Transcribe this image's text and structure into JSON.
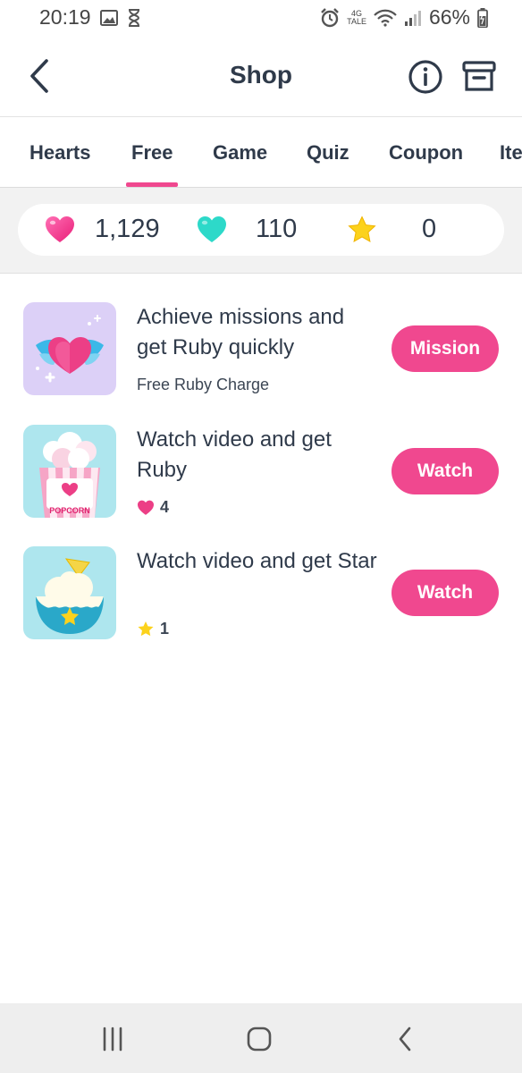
{
  "status_bar": {
    "time": "20:19",
    "network_label_top": "4G",
    "network_label_bottom": "TALE",
    "battery": "66%",
    "icons": [
      "image-icon",
      "hourglass-icon",
      "alarm-icon",
      "wifi-icon",
      "signal-icon",
      "battery-icon"
    ]
  },
  "app_bar": {
    "title": "Shop",
    "icons": [
      "back-icon",
      "info-icon",
      "archive-icon"
    ]
  },
  "tabs": [
    {
      "label": "Hearts",
      "active": false
    },
    {
      "label": "Free",
      "active": true
    },
    {
      "label": "Game",
      "active": false
    },
    {
      "label": "Quiz",
      "active": false
    },
    {
      "label": "Coupon",
      "active": false
    },
    {
      "label": "Ite",
      "active": false
    }
  ],
  "balances": {
    "pink_hearts": "1,129",
    "teal_hearts": "110",
    "stars": "0"
  },
  "offers": [
    {
      "title": "Achieve missions and get Ruby quickly",
      "subtitle": "Free Ruby Charge",
      "button": "Mission",
      "thumb": "winged-heart-image"
    },
    {
      "title": "Watch video and get Ruby",
      "reward_icon": "heart-icon",
      "reward": "4",
      "button": "Watch",
      "thumb": "popcorn-image",
      "thumb_text": "POPCORN"
    },
    {
      "title": "Watch video and get Star",
      "reward_icon": "star-icon",
      "reward": "1",
      "button": "Watch",
      "thumb": "ice-cream-bowl-image"
    }
  ],
  "colors": {
    "accent": "#f0488f",
    "teal": "#2dd9c9",
    "star": "#fcd21c",
    "text": "#2f3a4a"
  },
  "nav_bar": [
    "recents-icon",
    "home-icon",
    "back-nav-icon"
  ]
}
